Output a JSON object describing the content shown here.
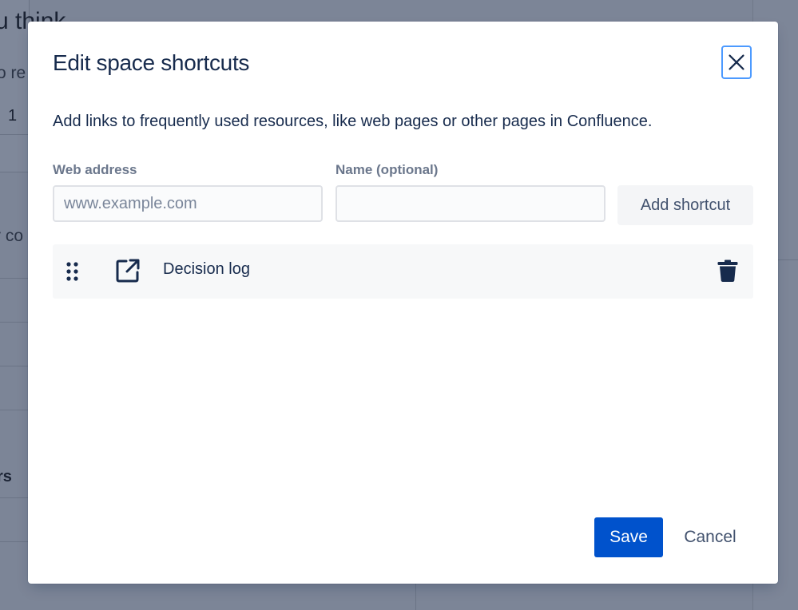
{
  "background": {
    "title_fragment": "u think",
    "subtitle_fragment": "o re",
    "number_fragment": "1",
    "subtitle2_fragment": "r co",
    "bold_fragment": "rs"
  },
  "modal": {
    "title": "Edit space shortcuts",
    "close_icon": "close-icon",
    "description": "Add links to frequently used resources, like web pages or other pages in Confluence.",
    "web_address": {
      "label": "Web address",
      "placeholder": "www.example.com",
      "value": ""
    },
    "name": {
      "label": "Name (optional)",
      "placeholder": "",
      "value": ""
    },
    "add_button": "Add shortcut",
    "shortcuts": [
      {
        "name": "Decision log",
        "icon": "external-link-icon"
      }
    ],
    "save_button": "Save",
    "cancel_button": "Cancel"
  },
  "colors": {
    "primary": "#0052cc",
    "focus_ring": "#4c9aff",
    "text": "#172b4d",
    "muted_label": "#6b778c",
    "overlay": "#7c8597"
  }
}
